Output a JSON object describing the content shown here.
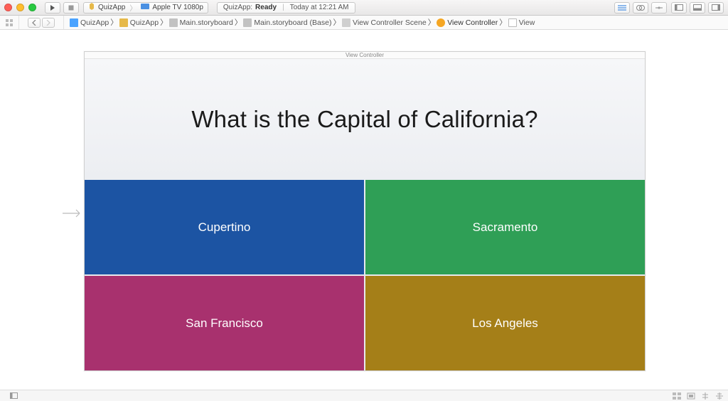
{
  "toolbar": {
    "scheme_app": "QuizApp",
    "scheme_device": "Apple TV 1080p",
    "status_app": "QuizApp:",
    "status_state": "Ready",
    "status_time": "Today at 12:21 AM"
  },
  "breadcrumb": {
    "items": [
      {
        "icon": "doc",
        "label": "QuizApp"
      },
      {
        "icon": "fold",
        "label": "QuizApp"
      },
      {
        "icon": "story",
        "label": "Main.storyboard"
      },
      {
        "icon": "story",
        "label": "Main.storyboard (Base)"
      },
      {
        "icon": "scene",
        "label": "View Controller Scene"
      },
      {
        "icon": "vc",
        "label": "View Controller"
      },
      {
        "icon": "view",
        "label": "View"
      }
    ]
  },
  "canvas": {
    "scene_title": "View Controller",
    "question": "What is the Capital of California?",
    "answers": [
      {
        "label": "Cupertino",
        "color": "#1c54a3"
      },
      {
        "label": "Sacramento",
        "color": "#2f9f56"
      },
      {
        "label": "San Francisco",
        "color": "#a8316e"
      },
      {
        "label": "Los Angeles",
        "color": "#a57f18"
      }
    ]
  }
}
